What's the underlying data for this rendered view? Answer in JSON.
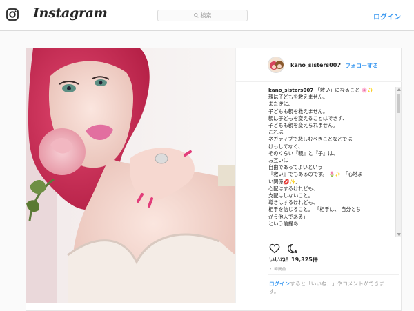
{
  "header": {
    "brand": "Instagram",
    "search_placeholder": "検索",
    "login_label": "ログイン"
  },
  "post": {
    "username": "kano_sisters007",
    "dot": "•",
    "follow_label": "フォローする",
    "caption_lines": [
      "「救い」になること",
      "親は子どもを救えません。",
      "また逆に、",
      "子どもも親を救えません。",
      " 親は子どもを変えることはできず、",
      "子どもも親を変えられません。",
      "これは",
      "ネガティブで悲しむべきことなどでは",
      "けっしてなく、",
      "そのくらい『親』と『子』は、",
      "お互いに",
      "自由であってよいという",
      "『救い』でもあるのです。 🌷✨ 「心地よ",
      "い関係💋✨」",
      "心配はするけれども、",
      "支配はしないこと。",
      "導きはするけれども、",
      "相手を信じること。 「相手は、 自分とち",
      "がう他人である」",
      "という前提あ"
    ],
    "likes_label": "いいね！19,325件",
    "time_label": "21時間前",
    "prompt_link": "ログイン",
    "prompt_text": "すると「いいね！」やコメントができます。"
  },
  "colors": {
    "accent": "#3897f0",
    "text": "#262626",
    "muted": "#999999"
  },
  "icons": [
    "instagram-camera-icon",
    "search-icon",
    "heart-icon",
    "comment-icon"
  ]
}
